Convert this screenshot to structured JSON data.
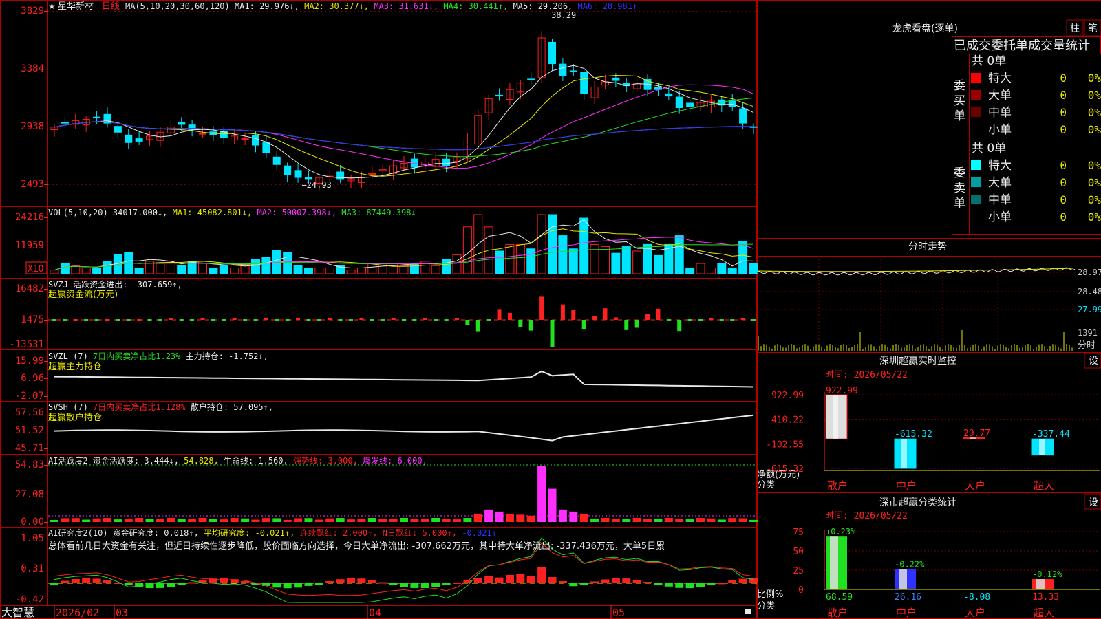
{
  "stock": {
    "star": "★",
    "name": "星华新材",
    "period": "日线"
  },
  "colors": {
    "bg": "#000000",
    "frame": "#b00000",
    "grid": "#7a0000",
    "up": "#ff2020",
    "down": "#00e5ff",
    "white": "#e8e8e8",
    "yellow": "#e6e600",
    "magenta": "#ff30ff",
    "green": "#20e020",
    "blue": "#3030ff",
    "gray": "#9a9a9a"
  },
  "kline": {
    "legend": [
      {
        "text": "MA(5,10,20,30,60,120)",
        "color": "#e8e8e8"
      },
      {
        "text": "MA1: 29.976↓,",
        "color": "#e8e8e8"
      },
      {
        "text": "MA2: 30.377↓,",
        "color": "#e6e600"
      },
      {
        "text": "MA3: 31.631↓,",
        "color": "#ff30ff"
      },
      {
        "text": "MA4: 30.441↑,",
        "color": "#20e020"
      },
      {
        "text": "MA5: 29.206,",
        "color": "#e8e8e8"
      },
      {
        "text": "MA6: 28.981↑",
        "color": "#3030ff"
      }
    ],
    "y_labels": [
      "3829",
      "3384",
      "2938",
      "2493"
    ],
    "high_label": "38.29",
    "low_label": "←24.93"
  },
  "volume": {
    "legend": [
      {
        "text": "VOL(5,10,20)",
        "color": "#e8e8e8"
      },
      {
        "text": "34017.000↓,",
        "color": "#e8e8e8"
      },
      {
        "text": "MA1: 45082.801↓,",
        "color": "#e6e600"
      },
      {
        "text": "MA2: 50007.398↓,",
        "color": "#ff30ff"
      },
      {
        "text": "MA3: 87449.398↓",
        "color": "#20e020"
      }
    ],
    "y_labels": [
      "24216",
      "11959"
    ],
    "multiplier": "X10"
  },
  "svzj": {
    "legend1": [
      {
        "text": "SVZJ",
        "color": "#e8e8e8"
      },
      {
        "text": "活跃资金进出: -307.659↑,",
        "color": "#e8e8e8"
      }
    ],
    "legend2": "超赢资金流(万元)",
    "y_labels": [
      "16482",
      "1475",
      "-13531"
    ]
  },
  "svzl": {
    "legend1": [
      {
        "text": "SVZL (7)",
        "color": "#e8e8e8"
      },
      {
        "text": "7日内买卖净占比1.23%",
        "color": "#20e020"
      },
      {
        "text": "主力持仓: -1.752↓,",
        "color": "#e8e8e8"
      }
    ],
    "legend2": "超赢主力持仓",
    "y_labels": [
      "15.99",
      "6.96",
      "-2.07"
    ]
  },
  "svsh": {
    "legend1": [
      {
        "text": "SVSH (7)",
        "color": "#e8e8e8"
      },
      {
        "text": "7日内买卖净占比1.128%",
        "color": "#ff2020"
      },
      {
        "text": "散户持仓: 57.095↑,",
        "color": "#e8e8e8"
      }
    ],
    "legend2": "超赢散户持仓",
    "y_labels": [
      "57.56",
      "51.52",
      "45.71"
    ]
  },
  "ai1": {
    "legend": [
      {
        "text": "AI活跃度2",
        "color": "#e8e8e8"
      },
      {
        "text": "资金活跃度: 3.444↓,",
        "color": "#e8e8e8"
      },
      {
        "text": "54.828,",
        "color": "#e6e600"
      },
      {
        "text": "生命线: 1.560,",
        "color": "#e8e8e8"
      },
      {
        "text": "强势线: 3.000,",
        "color": "#ff2020"
      },
      {
        "text": "爆发线: 6.000,",
        "color": "#ff30ff"
      }
    ],
    "y_labels": [
      "54.83",
      "27.08",
      "0.00"
    ]
  },
  "ai2": {
    "legend": [
      {
        "text": "AI研究度2(10)",
        "color": "#e8e8e8"
      },
      {
        "text": "资金研究度: 0.018↑,",
        "color": "#e8e8e8"
      },
      {
        "text": "平均研究度: -0.021↑,",
        "color": "#e6e600"
      },
      {
        "text": "连续飘红: 2.000↑,",
        "color": "#ff2020"
      },
      {
        "text": "N日飘红: 5.000↑,",
        "color": "#ff2020"
      },
      {
        "text": "-0.021↑",
        "color": "#3030ff"
      }
    ],
    "comment": "总体看前几日大资金有关注，但近日持续性逐步降低，股价面临方向选择，今日大单净流出: -307.662万元，其中特大单净流出: -337.436万元，大单5日累",
    "y_labels": [
      "1.05",
      "0.31",
      "-0.42"
    ]
  },
  "x_axis": {
    "brand": "大智慧",
    "dates": [
      "2026/02",
      "03",
      "04",
      "05"
    ]
  },
  "dragon": {
    "title": "龙虎看盘(逐单)",
    "tab1": "柱",
    "tab2": "笔",
    "subtitle": "已成交委托单成交量统计",
    "buy": {
      "side": "委买单",
      "total": "共 0单",
      "rows": [
        {
          "label": "特大",
          "value": "0",
          "pct": "0%",
          "color": "#ff0000"
        },
        {
          "label": "大单",
          "value": "0",
          "pct": "0%",
          "color": "#9a0000"
        },
        {
          "label": "中单",
          "value": "0",
          "pct": "0%",
          "color": "#6a0000"
        },
        {
          "label": "小单",
          "value": "0",
          "pct": "0%",
          "color": ""
        }
      ]
    },
    "sell": {
      "side": "委卖单",
      "total": "共 0单",
      "rows": [
        {
          "label": "特大",
          "value": "0",
          "pct": "0%",
          "color": "#00ffff"
        },
        {
          "label": "大单",
          "value": "0",
          "pct": "0%",
          "color": "#00a0a0"
        },
        {
          "label": "中单",
          "value": "0",
          "pct": "0%",
          "color": "#007070"
        },
        {
          "label": "小单",
          "value": "0",
          "pct": "0%",
          "color": ""
        }
      ]
    }
  },
  "intraday": {
    "title": "分时走势",
    "price_labels": [
      "28.97",
      "28.48",
      "27.99"
    ],
    "vol_label": "1391",
    "unit_label": "分时"
  },
  "sz_monitor": {
    "title": "深圳超赢实时监控",
    "set": "设",
    "time": "时间: 2026/05/22",
    "y_labels": [
      "922.99",
      "410.22",
      "-102.55",
      "-615.32"
    ],
    "ylabel": "净额(万元)",
    "xlabel": "分类",
    "categories": [
      "散户",
      "中户",
      "大户",
      "超大"
    ],
    "values": [
      922.99,
      -615.32,
      29.77,
      -337.44
    ],
    "value_labels": [
      "922.99",
      "-615.32",
      "29.77",
      "-337.44"
    ]
  },
  "sz_class": {
    "title": "深市超赢分类统计",
    "set": "设",
    "time": "时间: 2026/05/22",
    "y_labels": [
      "75",
      "50",
      "25",
      "0"
    ],
    "ylabel": "比例%",
    "xlabel": "分类",
    "categories": [
      "散户",
      "中户",
      "大户",
      "超大"
    ],
    "values": [
      68.59,
      26.16,
      -8.08,
      13.33
    ],
    "value_labels": [
      "68.59",
      "26.16",
      "-8.08",
      "13.33"
    ],
    "change_labels": [
      "+0.23%",
      "-0.22%",
      "",
      "-0.12%"
    ]
  },
  "chart_data": [
    {
      "type": "bar",
      "title": "深圳超赢实时监控",
      "xlabel": "分类",
      "ylabel": "净额(万元)",
      "categories": [
        "散户",
        "中户",
        "大户",
        "超大"
      ],
      "values": [
        922.99,
        -615.32,
        29.77,
        -337.44
      ],
      "ylim": [
        -615.32,
        922.99
      ]
    },
    {
      "type": "bar",
      "title": "深市超赢分类统计",
      "xlabel": "分类",
      "ylabel": "比例%",
      "categories": [
        "散户",
        "中户",
        "大户",
        "超大"
      ],
      "values": [
        68.59,
        26.16,
        -8.08,
        13.33
      ],
      "ylim": [
        0,
        75
      ]
    },
    {
      "type": "line",
      "title": "星华新材 日线",
      "y_range": [
        24.93,
        38.29
      ],
      "close": [
        29.6,
        29.9,
        30.1,
        30.2,
        30.3,
        29.9,
        29.2,
        28.4,
        28.5,
        28.9,
        29.2,
        29.6,
        29.8,
        29.4,
        29.1,
        29.0,
        28.8,
        28.9,
        28.7,
        28.2,
        27.6,
        26.7,
        25.9,
        25.7,
        25.6,
        25.7,
        25.8,
        25.6,
        25.6,
        25.7,
        26.0,
        26.3,
        26.6,
        26.8,
        26.5,
        26.9,
        27.1,
        26.6,
        27.3,
        28.6,
        30.5,
        31.8,
        32.0,
        32.5,
        33.0,
        33.3,
        36.5,
        34.5,
        33.6,
        33.9,
        32.2,
        32.7,
        33.1,
        33.2,
        32.8,
        33.0,
        32.5,
        32.5,
        32.0,
        31.1,
        31.2,
        31.5,
        31.6,
        31.3,
        31.2,
        29.9,
        29.6
      ],
      "ma": [
        "MA1",
        "MA2",
        "MA3",
        "MA4",
        "MA5",
        "MA6"
      ]
    },
    {
      "type": "bar",
      "title": "VOL",
      "y_range": [
        0,
        24216
      ]
    },
    {
      "type": "bar",
      "title": "SVZJ 超赢资金流(万元)",
      "y_range": [
        -13531,
        16482
      ]
    },
    {
      "type": "line",
      "title": "SVZL 超赢主力持仓",
      "y_range": [
        -2.07,
        15.99
      ]
    },
    {
      "type": "line",
      "title": "SVSH 超赢散户持仓",
      "y_range": [
        45.71,
        57.56
      ]
    },
    {
      "type": "bar",
      "title": "AI活跃度2",
      "y_range": [
        0,
        54.83
      ]
    },
    {
      "type": "bar",
      "title": "AI研究度2(10)",
      "y_range": [
        -0.42,
        1.05
      ]
    }
  ]
}
